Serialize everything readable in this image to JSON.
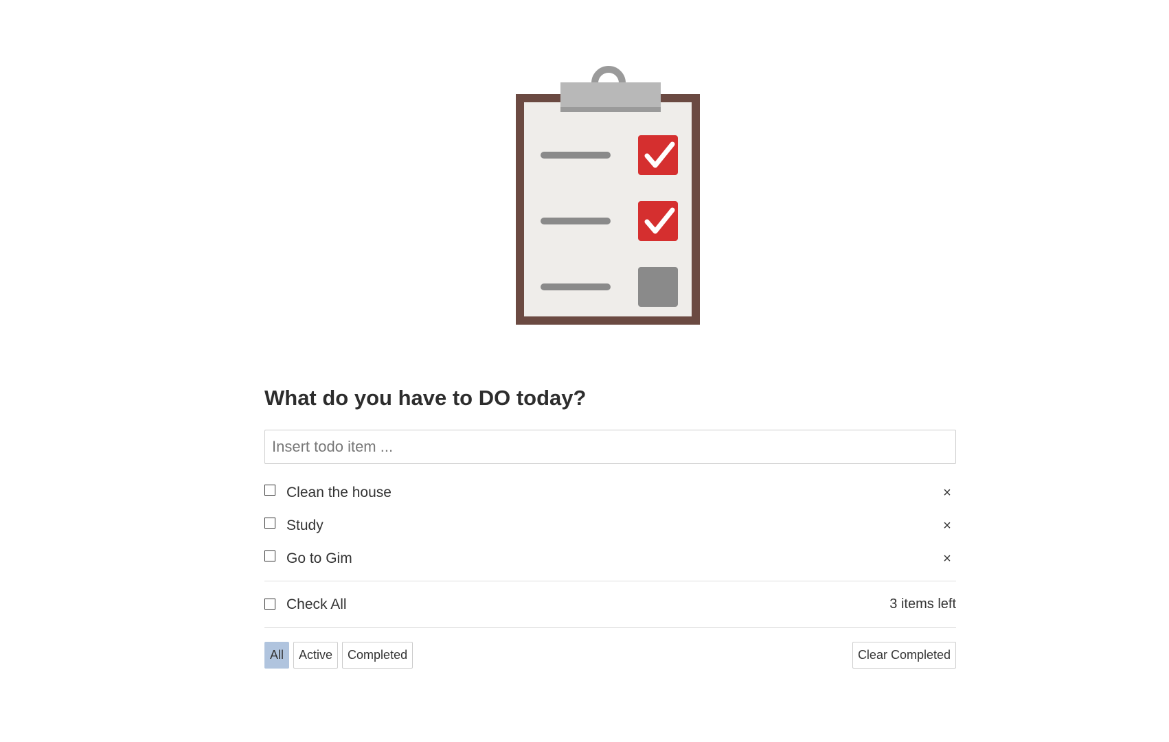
{
  "logo": {
    "icon": "clipboard-checklist-icon",
    "colors": {
      "board": "#6b4a42",
      "paper": "#efedea",
      "clip": "#b8b8b8",
      "clip_dark": "#9a9a9a",
      "line": "#8a8a8a",
      "checked": "#d52f2f",
      "unchecked": "#8a8a8a"
    },
    "rows": [
      {
        "checked": true
      },
      {
        "checked": true
      },
      {
        "checked": false
      }
    ]
  },
  "header": {
    "title": "What do you have to DO today?"
  },
  "new_todo": {
    "placeholder": "Insert todo item ...",
    "value": ""
  },
  "todos": [
    {
      "text": "Clean the house",
      "completed": false,
      "delete_label": "×"
    },
    {
      "text": "Study",
      "completed": false,
      "delete_label": "×"
    },
    {
      "text": "Go to Gim",
      "completed": false,
      "delete_label": "×"
    }
  ],
  "footer": {
    "check_all_label": "Check All",
    "items_left": "3 items left"
  },
  "filters": {
    "all": "All",
    "active": "Active",
    "completed": "Completed",
    "selected": "All",
    "selected_color": "#b0c4de"
  },
  "actions": {
    "clear_completed": "Clear Completed"
  }
}
